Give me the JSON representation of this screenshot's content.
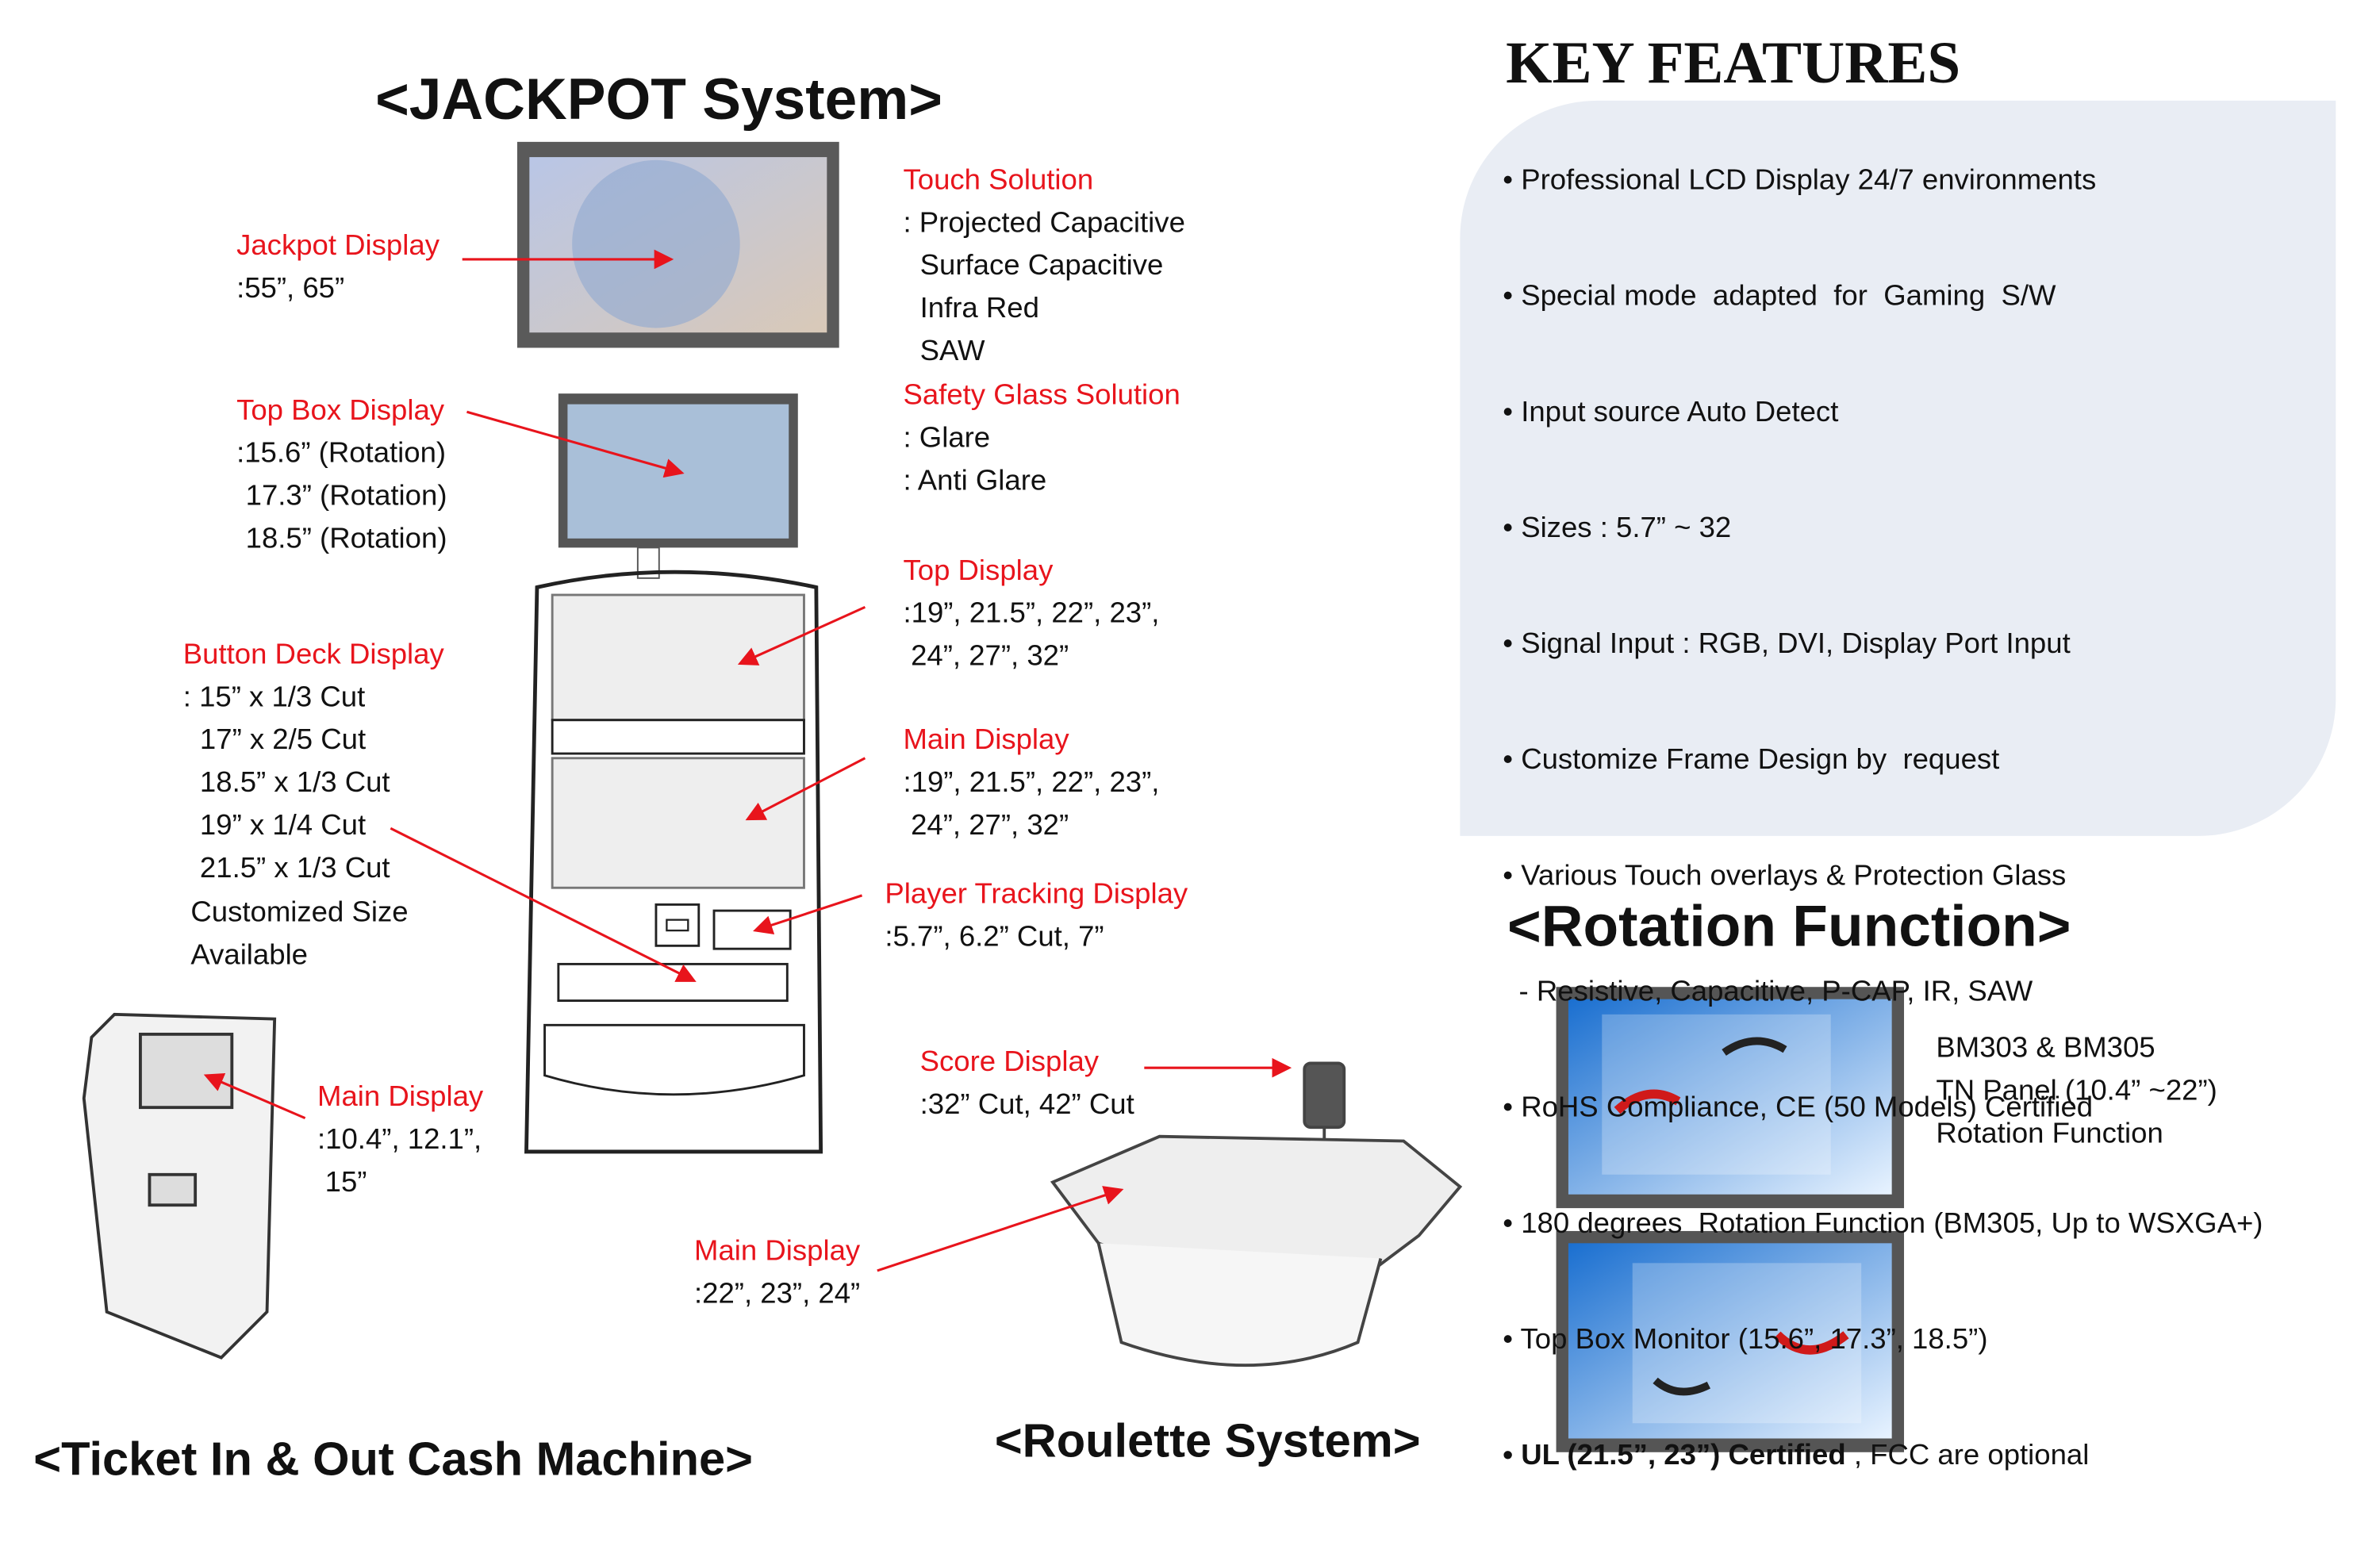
{
  "jackpot": {
    "title": "<JACKPOT System>",
    "jackpot_display": {
      "label": "Jackpot Display",
      "lines": [
        ":55”, 65”"
      ]
    },
    "touch_solution": {
      "label": "Touch Solution",
      "lines": [
        ": Projected Capacitive",
        "Surface Capacitive",
        "Infra Red",
        "SAW"
      ]
    },
    "safety_glass": {
      "label": "Safety Glass Solution",
      "lines": [
        ": Glare",
        ": Anti Glare"
      ]
    },
    "top_box_display": {
      "label": "Top Box Display",
      "lines": [
        ":15.6” (Rotation)",
        "17.3” (Rotation)",
        "18.5” (Rotation)"
      ]
    },
    "top_display": {
      "label": "Top Display",
      "lines": [
        ":19”, 21.5”, 22”, 23”,",
        "24”, 27”, 32”"
      ]
    },
    "button_deck": {
      "label": "Button Deck Display",
      "lines": [
        ": 15” x 1/3 Cut",
        "17” x 2/5 Cut",
        "18.5” x 1/3 Cut",
        "19” x 1/4 Cut",
        "21.5” x 1/3 Cut",
        "Customized Size",
        "Available"
      ]
    },
    "main_display": {
      "label": "Main Display",
      "lines": [
        ":19”, 21.5”, 22”, 23”,",
        "24”, 27”, 32”"
      ]
    },
    "player_tracking": {
      "label": "Player Tracking Display",
      "lines": [
        ":5.7”, 6.2” Cut, 7”"
      ]
    }
  },
  "ticket": {
    "title": "<Ticket In & Out Cash Machine>",
    "main_display": {
      "label": "Main Display",
      "lines": [
        ":10.4”, 12.1”,",
        "15”"
      ]
    }
  },
  "roulette": {
    "title": "<Roulette System>",
    "score_display": {
      "label": "Score Display",
      "lines": [
        ":32” Cut, 42” Cut"
      ]
    },
    "main_display": {
      "label": "Main Display",
      "lines": [
        ":22”, 23”, 24”"
      ]
    }
  },
  "key_features": {
    "title": "KEY FEATURES",
    "items": [
      "• Professional LCD Display 24/7 environments",
      "• Special mode  adapted  for  Gaming  S/W",
      "• Input source Auto Detect",
      "• Sizes : 5.7” ~ 32",
      "• Signal Input : RGB, DVI, Display Port Input",
      "• Customize Frame Design by  request",
      "• Various Touch overlays & Protection Glass",
      "  - Resistive, Capacitive, P-CAP, IR, SAW",
      "• RoHS Compliance, CE (50 Models) Certified",
      "• 180 degrees  Rotation Function (BM305, Up to WSXGA+)",
      "• Top Box Monitor (15.6”, 17.3”, 18.5”)"
    ],
    "last_bold": "• UL (21.5”, 23”) Certified",
    "last_rest": " , FCC are optional",
    "panel_color": "#e9edf4"
  },
  "rotation": {
    "title": "<Rotation Function>",
    "lines": [
      "BM303 & BM305",
      "TN Panel (10.4” ~22”)",
      "Rotation Function"
    ]
  },
  "colors": {
    "label_red": "#e8141c",
    "arrow_red": "#e8141c"
  }
}
